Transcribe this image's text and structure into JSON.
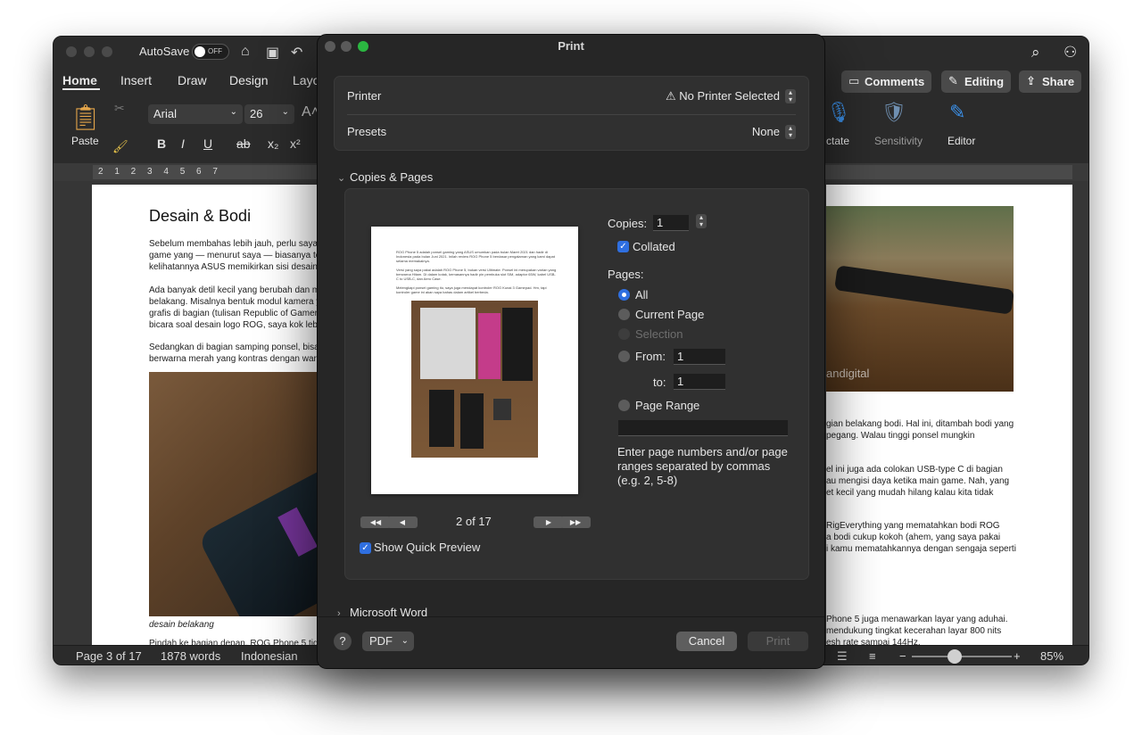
{
  "word": {
    "autosave_label": "AutoSave",
    "toggle_state": "OFF",
    "tabs": [
      "Home",
      "Insert",
      "Draw",
      "Design",
      "Layo"
    ],
    "comments_label": "Comments",
    "editing_label": "Editing",
    "share_label": "Share",
    "paste_label": "Paste",
    "font_name": "Arial",
    "font_size": "26",
    "dictate_label": "ctate",
    "sensitivity_label": "Sensitivity",
    "editor_label": "Editor",
    "ruler_numbers": "2 1 2 3 4 5 6 7",
    "doc_title": "Desain & Bodi",
    "left_paragraphs": [
      "Sebelum membahas lebih jauh, perlu saya",
      "game yang — menurut saya — biasanya te",
      "kelihatannya ASUS memikirkan sisi desain",
      "",
      "Ada banyak detil kecil yang berubah dan m",
      "belakang. Misalnya bentuk modul kamera y",
      "grafis di bagian (tulisan Republic of Gamers",
      "bicara soal desain logo ROG, saya kok lebi",
      "",
      "Sedangkan di bagian samping ponsel, bisa",
      "berwarna merah yang kontras dengan warn"
    ],
    "caption": "desain belakang",
    "left_bottom_line": "Pindah ke bagian depan, ROG Phone 5 tid",
    "photo_watermark": "andigital",
    "right_paragraphs": [
      "gian belakang bodi. Hal ini, ditambah bodi yang",
      "pegang. Walau tinggi ponsel mungkin",
      "",
      "",
      "el ini juga ada colokan USB-type C di bagian",
      "au mengisi daya ketika main game. Nah, yang",
      "et kecil yang mudah hilang kalau kita tidak",
      "",
      "",
      "RigEverything yang mematahkan bodi ROG",
      "a bodi cukup kokoh (ahem, yang saya pakai",
      "i kamu mematahkannya dengan sengaja seperti",
      "",
      "",
      "",
      "",
      "Phone 5 juga menawarkan layar yang aduhai.",
      "mendukung tingkat kecerahan layar 800 nits",
      "esh rate sampai 144Hz."
    ],
    "status_page": "Page 3 of 17",
    "status_words": "1878 words",
    "status_language": "Indonesian",
    "zoom": "85%"
  },
  "print": {
    "title": "Print",
    "printer_label": "Printer",
    "printer_value": "No Printer Selected",
    "presets_label": "Presets",
    "presets_value": "None",
    "copies_pages_label": "Copies & Pages",
    "copies_label": "Copies:",
    "copies_value": "1",
    "collated_label": "Collated",
    "pages_label": "Pages:",
    "page_options": [
      "All",
      "Current Page",
      "Selection",
      "From:",
      "Page Range"
    ],
    "from_value": "1",
    "to_label": "to:",
    "to_value": "1",
    "help_text": "Enter page numbers and/or page ranges separated by commas (e.g. 2, 5-8)",
    "page_indicator": "2 of 17",
    "quick_preview_label": "Show Quick Preview",
    "microsoft_word_label": "Microsoft Word",
    "pdf_label": "PDF",
    "cancel_label": "Cancel",
    "print_label": "Print",
    "help_glyph": "?"
  },
  "preview": {
    "lines": [
      "ROG Phone 5 adalah ponsel gaming yang ASUS umumkan pada bulan Maret 2021 dan hadir di Indonesia pada bulan Juni 2021. Inilah review ROG Phone 5 berdasar pengalaman yang kami dapat selama memakainya.",
      "Versi yang saya pakai adalah ROG Phone 5, bukan versi Ultimate. Ponsel ini merupakan varian yang berwarna Hitam. Di dalam kotak, kemasannya hadir pin pembuka slot SIM, adaptor 65W, kabel USB-C to USB-C, dan Aero Case.",
      "Melengkapi ponsel gaming itu, saya juga mendapat kontroler ROG Kunai 3 Gamepad. Hm, tapi kontroler game ini akan saya bahas dalam artikel berbeda."
    ]
  },
  "colors": {
    "accent_blue": "#2f6fe0",
    "close_red": "#5a5a5a",
    "zoom_green": "#2bb741"
  }
}
